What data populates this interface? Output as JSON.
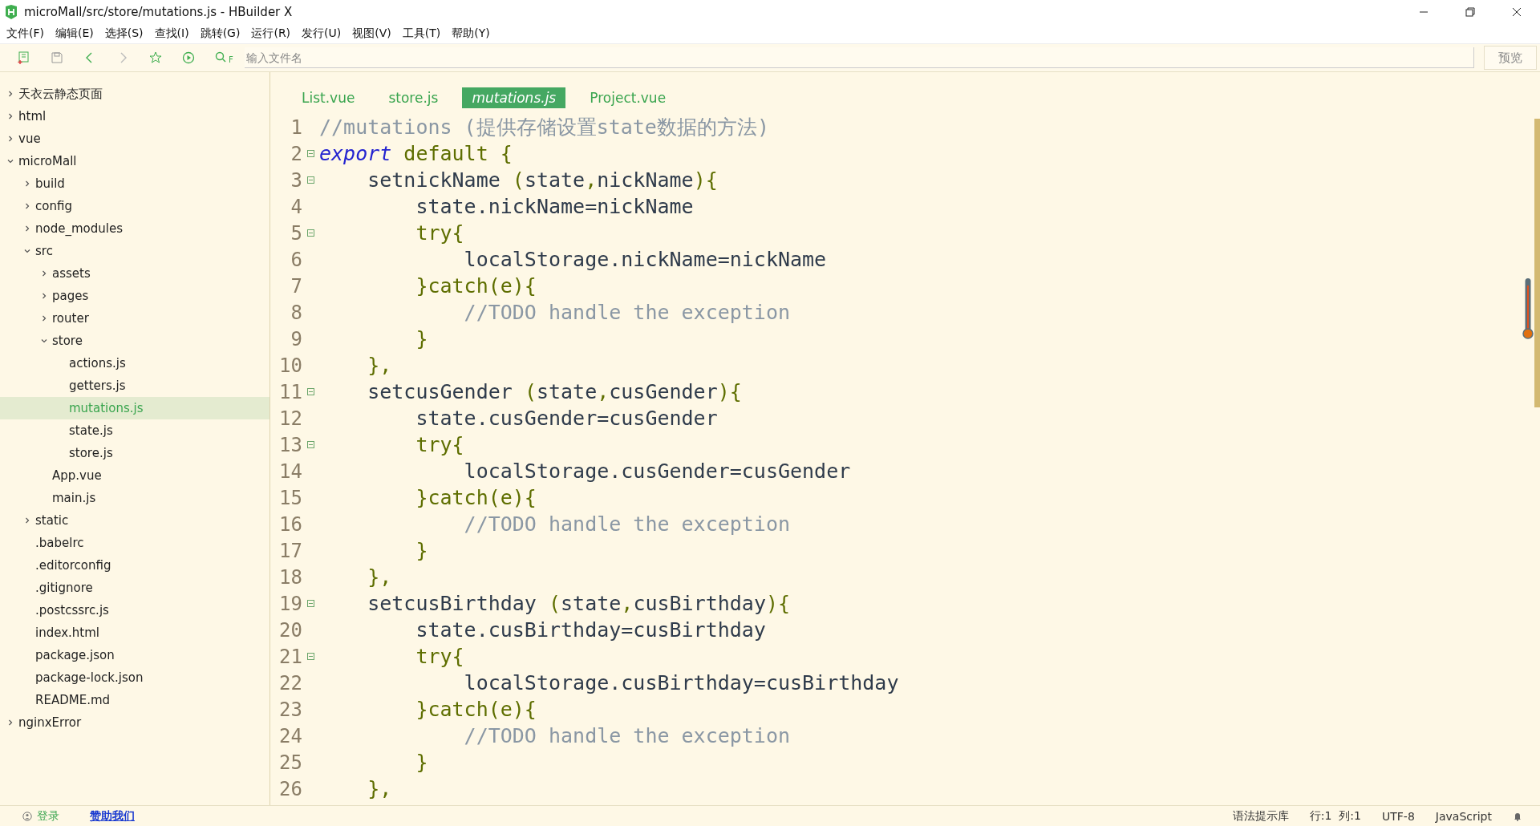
{
  "window": {
    "title": "microMall/src/store/mutations.js - HBuilder X"
  },
  "menu": [
    "文件(F)",
    "编辑(E)",
    "选择(S)",
    "查找(I)",
    "跳转(G)",
    "运行(R)",
    "发行(U)",
    "视图(V)",
    "工具(T)",
    "帮助(Y)"
  ],
  "toolbar": {
    "search_label": "F",
    "placeholder": "输入文件名",
    "preview_button": "预览"
  },
  "sidebar": {
    "items": [
      {
        "label": "天衣云静态页面",
        "kind": "folder",
        "expanded": false,
        "selected": false
      },
      {
        "label": "html",
        "kind": "folder",
        "expanded": false,
        "selected": false
      },
      {
        "label": "vue",
        "kind": "folder",
        "expanded": false,
        "selected": false
      },
      {
        "label": "microMall",
        "kind": "folder",
        "expanded": true,
        "selected": false,
        "children": [
          {
            "label": "build",
            "kind": "folder",
            "expanded": false,
            "selected": false
          },
          {
            "label": "config",
            "kind": "folder",
            "expanded": false,
            "selected": false
          },
          {
            "label": "node_modules",
            "kind": "folder",
            "expanded": false,
            "selected": false
          },
          {
            "label": "src",
            "kind": "folder",
            "expanded": true,
            "selected": false,
            "children": [
              {
                "label": "assets",
                "kind": "folder",
                "expanded": false,
                "selected": false
              },
              {
                "label": "pages",
                "kind": "folder",
                "expanded": false,
                "selected": false
              },
              {
                "label": "router",
                "kind": "folder",
                "expanded": false,
                "selected": false
              },
              {
                "label": "store",
                "kind": "folder",
                "expanded": true,
                "selected": false,
                "children": [
                  {
                    "label": "actions.js",
                    "kind": "file",
                    "selected": false
                  },
                  {
                    "label": "getters.js",
                    "kind": "file",
                    "selected": false
                  },
                  {
                    "label": "mutations.js",
                    "kind": "file",
                    "selected": true
                  },
                  {
                    "label": "state.js",
                    "kind": "file",
                    "selected": false
                  },
                  {
                    "label": "store.js",
                    "kind": "file",
                    "selected": false
                  }
                ]
              },
              {
                "label": "App.vue",
                "kind": "file",
                "selected": false
              },
              {
                "label": "main.js",
                "kind": "file",
                "selected": false
              }
            ]
          },
          {
            "label": "static",
            "kind": "folder",
            "expanded": false,
            "selected": false
          },
          {
            "label": ".babelrc",
            "kind": "file",
            "selected": false
          },
          {
            "label": ".editorconfig",
            "kind": "file",
            "selected": false
          },
          {
            "label": ".gitignore",
            "kind": "file",
            "selected": false
          },
          {
            "label": ".postcssrc.js",
            "kind": "file",
            "selected": false
          },
          {
            "label": "index.html",
            "kind": "file",
            "selected": false
          },
          {
            "label": "package.json",
            "kind": "file",
            "selected": false
          },
          {
            "label": "package-lock.json",
            "kind": "file",
            "selected": false
          },
          {
            "label": "README.md",
            "kind": "file",
            "selected": false
          }
        ]
      },
      {
        "label": "nginxError",
        "kind": "folder",
        "expanded": false,
        "selected": false
      }
    ]
  },
  "tabs": [
    {
      "label": "List.vue",
      "selected": false
    },
    {
      "label": "store.js",
      "selected": false
    },
    {
      "label": "mutations.js",
      "selected": true
    },
    {
      "label": "Project.vue",
      "selected": false
    }
  ],
  "code_lines": [
    {
      "number": "1",
      "foldable": false,
      "tokens": [
        {
          "kind": "comment",
          "text": "//mutations (提供存储设置state数据的方法)"
        }
      ]
    },
    {
      "number": "2",
      "foldable": true,
      "tokens": [
        {
          "kind": "keyword",
          "text": "export"
        },
        {
          "kind": "punct",
          "text": " default {"
        }
      ]
    },
    {
      "number": "3",
      "foldable": true,
      "tokens": [
        {
          "kind": "plain",
          "text": "    setnickName "
        },
        {
          "kind": "punct",
          "text": "("
        },
        {
          "kind": "plain",
          "text": "state"
        },
        {
          "kind": "punct",
          "text": ","
        },
        {
          "kind": "plain",
          "text": "nickName"
        },
        {
          "kind": "punct",
          "text": "){"
        }
      ]
    },
    {
      "number": "4",
      "foldable": false,
      "tokens": [
        {
          "kind": "plain",
          "text": "        state.nickName=nickName"
        }
      ]
    },
    {
      "number": "5",
      "foldable": true,
      "tokens": [
        {
          "kind": "punct",
          "text": "        try{"
        }
      ]
    },
    {
      "number": "6",
      "foldable": false,
      "tokens": [
        {
          "kind": "plain",
          "text": "            localStorage.nickName=nickName"
        }
      ]
    },
    {
      "number": "7",
      "foldable": false,
      "tokens": [
        {
          "kind": "punct",
          "text": "        }catch(e){"
        }
      ]
    },
    {
      "number": "8",
      "foldable": false,
      "tokens": [
        {
          "kind": "comment",
          "text": "            //TODO handle the exception"
        }
      ]
    },
    {
      "number": "9",
      "foldable": false,
      "tokens": [
        {
          "kind": "punct",
          "text": "        }"
        }
      ]
    },
    {
      "number": "10",
      "foldable": false,
      "tokens": [
        {
          "kind": "punct",
          "text": "    },"
        }
      ]
    },
    {
      "number": "11",
      "foldable": true,
      "tokens": [
        {
          "kind": "plain",
          "text": "    setcusGender "
        },
        {
          "kind": "punct",
          "text": "("
        },
        {
          "kind": "plain",
          "text": "state"
        },
        {
          "kind": "punct",
          "text": ","
        },
        {
          "kind": "plain",
          "text": "cusGender"
        },
        {
          "kind": "punct",
          "text": "){"
        }
      ]
    },
    {
      "number": "12",
      "foldable": false,
      "tokens": [
        {
          "kind": "plain",
          "text": "        state.cusGender=cusGender"
        }
      ]
    },
    {
      "number": "13",
      "foldable": true,
      "tokens": [
        {
          "kind": "punct",
          "text": "        try{"
        }
      ]
    },
    {
      "number": "14",
      "foldable": false,
      "tokens": [
        {
          "kind": "plain",
          "text": "            localStorage.cusGender=cusGender"
        }
      ]
    },
    {
      "number": "15",
      "foldable": false,
      "tokens": [
        {
          "kind": "punct",
          "text": "        }catch(e){"
        }
      ]
    },
    {
      "number": "16",
      "foldable": false,
      "tokens": [
        {
          "kind": "comment",
          "text": "            //TODO handle the exception"
        }
      ]
    },
    {
      "number": "17",
      "foldable": false,
      "tokens": [
        {
          "kind": "punct",
          "text": "        }"
        }
      ]
    },
    {
      "number": "18",
      "foldable": false,
      "tokens": [
        {
          "kind": "punct",
          "text": "    },"
        }
      ]
    },
    {
      "number": "19",
      "foldable": true,
      "tokens": [
        {
          "kind": "plain",
          "text": "    setcusBirthday "
        },
        {
          "kind": "punct",
          "text": "("
        },
        {
          "kind": "plain",
          "text": "state"
        },
        {
          "kind": "punct",
          "text": ","
        },
        {
          "kind": "plain",
          "text": "cusBirthday"
        },
        {
          "kind": "punct",
          "text": "){"
        }
      ]
    },
    {
      "number": "20",
      "foldable": false,
      "tokens": [
        {
          "kind": "plain",
          "text": "        state.cusBirthday=cusBirthday"
        }
      ]
    },
    {
      "number": "21",
      "foldable": true,
      "tokens": [
        {
          "kind": "punct",
          "text": "        try{"
        }
      ]
    },
    {
      "number": "22",
      "foldable": false,
      "tokens": [
        {
          "kind": "plain",
          "text": "            localStorage.cusBirthday=cusBirthday"
        }
      ]
    },
    {
      "number": "23",
      "foldable": false,
      "tokens": [
        {
          "kind": "punct",
          "text": "        }catch(e){"
        }
      ]
    },
    {
      "number": "24",
      "foldable": false,
      "tokens": [
        {
          "kind": "comment",
          "text": "            //TODO handle the exception"
        }
      ]
    },
    {
      "number": "25",
      "foldable": false,
      "tokens": [
        {
          "kind": "punct",
          "text": "        }"
        }
      ]
    },
    {
      "number": "26",
      "foldable": false,
      "tokens": [
        {
          "kind": "punct",
          "text": "    },"
        }
      ]
    }
  ],
  "status_bar": {
    "login": "登录",
    "sponsor_link": "赞助我们",
    "syntax_library": "语法提示库",
    "position": "行:1  列:1",
    "encoding": "UTF-8",
    "language": "JavaScript"
  }
}
